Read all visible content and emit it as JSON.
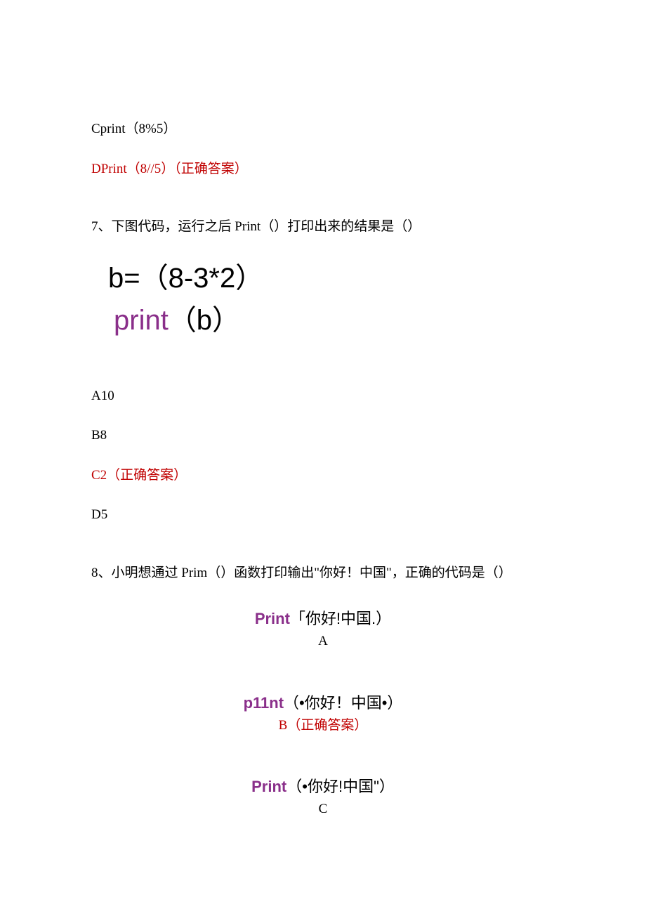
{
  "q6": {
    "optC": "Cprint（8%5）",
    "optD": "DPrint（8//5）（正确答案）"
  },
  "q7": {
    "question": "7、下图代码，运行之后 Print（）打印出来的结果是（）",
    "code_line1": "b=（8-3*2）",
    "code_line2_kw": "print",
    "code_line2_rest": "（b）",
    "optA": "A10",
    "optB": "B8",
    "optC": "C2（正确答案）",
    "optD": "D5"
  },
  "q8": {
    "question": "8、小明想通过 Prim（）函数打印输出\"你好！中国\"，正确的代码是（）",
    "optA_kw": "Print",
    "optA_rest": "「你好!中国.）",
    "optA_label": "A",
    "optB_kw": "p11nt",
    "optB_rest": "（•你好！中国•）",
    "optB_label": "B（正确答案）",
    "optC_kw": "Print",
    "optC_rest": "（•你好!中国\"）",
    "optC_label": "C"
  }
}
